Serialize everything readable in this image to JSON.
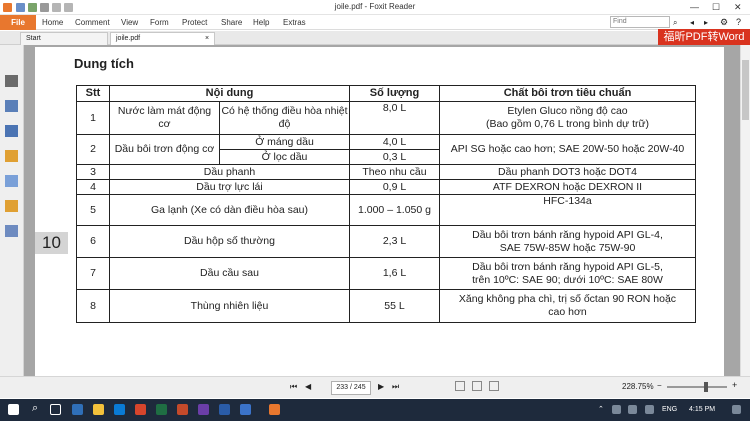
{
  "window": {
    "title": "joile.pdf - Foxit Reader",
    "minimize_glyph": "—",
    "maximize_glyph": "☐",
    "close_glyph": "✕"
  },
  "ribbon": {
    "file_label": "File",
    "menu": [
      "Home",
      "Comment",
      "View",
      "Form",
      "Protect",
      "Share",
      "Help",
      "Extras"
    ],
    "find_placeholder": "Find"
  },
  "tabs": [
    {
      "label": "Start"
    },
    {
      "label": "joile.pdf"
    }
  ],
  "ad_banner": "福昕PDF转Word",
  "document": {
    "page_number_marker": "10",
    "heading": "Dung tích",
    "table": {
      "headers": [
        "Stt",
        "Nội dung",
        "Số lượng",
        "Chất bôi trơn tiêu chuẩn"
      ],
      "rows": {
        "r1": {
          "stt": "1",
          "item": "Nước làm mát động cơ",
          "sub": "Có hệ thống điều hòa nhiệt độ",
          "qty": "8,0 L",
          "spec1": "Etylen Gluco nồng độ cao",
          "spec2": "(Bao gồm 0,76 L trong bình dự trữ)"
        },
        "r2a": {
          "stt": "2",
          "item": "Dầu bôi trơn động cơ",
          "sub": "Ở máng dầu",
          "qty": "4,0 L",
          "spec": "API SG hoặc cao hơn; SAE 20W-50 hoặc 20W-40"
        },
        "r2b": {
          "sub": "Ở lọc dầu",
          "qty": "0,3 L"
        },
        "r3": {
          "stt": "3",
          "item": "Dầu phanh",
          "qty": "Theo nhu cầu",
          "spec": "Dầu phanh DOT3 hoặc DOT4"
        },
        "r4": {
          "stt": "4",
          "item": "Dầu trợ lực lái",
          "qty": "0,9 L",
          "spec": "ATF DEXRON hoặc DEXRON II"
        },
        "r5": {
          "stt": "5",
          "item": "Ga lạnh (Xe có dàn điều hòa sau)",
          "qty": "1.000 – 1.050 g",
          "spec": "HFC-134a"
        },
        "r6": {
          "stt": "6",
          "item": "Dầu hộp số thường",
          "qty": "2,3 L",
          "spec1": "Dầu bôi trơn bánh răng hypoid API GL-4,",
          "spec2": "SAE 75W-85W hoặc 75W-90"
        },
        "r7": {
          "stt": "7",
          "item": "Dầu cầu sau",
          "qty": "1,6 L",
          "spec1": "Dầu bôi trơn bánh răng hypoid API GL-5,",
          "spec2": "trên 10ºC: SAE 90; dưới 10ºC: SAE 80W"
        },
        "r8": {
          "stt": "8",
          "item": "Thùng nhiên liệu",
          "qty": "55 L",
          "spec1": "Xăng không pha chì, trị số ốctan 90 RON hoặc",
          "spec2": "cao hơn"
        }
      }
    }
  },
  "statusbar": {
    "page_indicator": "233 / 245",
    "zoom": "228.75%"
  },
  "taskbar": {
    "language": "ENG",
    "time": "4:15 PM"
  },
  "colors": {
    "file_tab": "#e8772e",
    "ad_banner": "#d9331f",
    "taskbar": "#1e2a3c"
  }
}
